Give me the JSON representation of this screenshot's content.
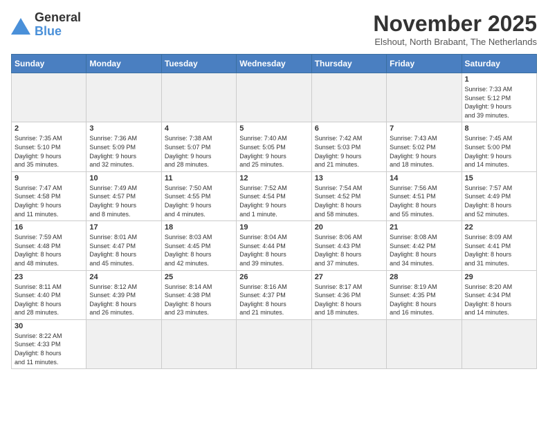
{
  "header": {
    "logo_line1": "General",
    "logo_line2": "Blue",
    "month_title": "November 2025",
    "location": "Elshout, North Brabant, The Netherlands"
  },
  "weekdays": [
    "Sunday",
    "Monday",
    "Tuesday",
    "Wednesday",
    "Thursday",
    "Friday",
    "Saturday"
  ],
  "weeks": [
    [
      {
        "day": "",
        "info": "",
        "empty": true
      },
      {
        "day": "",
        "info": "",
        "empty": true
      },
      {
        "day": "",
        "info": "",
        "empty": true
      },
      {
        "day": "",
        "info": "",
        "empty": true
      },
      {
        "day": "",
        "info": "",
        "empty": true
      },
      {
        "day": "",
        "info": "",
        "empty": true
      },
      {
        "day": "1",
        "info": "Sunrise: 7:33 AM\nSunset: 5:12 PM\nDaylight: 9 hours\nand 39 minutes."
      }
    ],
    [
      {
        "day": "2",
        "info": "Sunrise: 7:35 AM\nSunset: 5:10 PM\nDaylight: 9 hours\nand 35 minutes."
      },
      {
        "day": "3",
        "info": "Sunrise: 7:36 AM\nSunset: 5:09 PM\nDaylight: 9 hours\nand 32 minutes."
      },
      {
        "day": "4",
        "info": "Sunrise: 7:38 AM\nSunset: 5:07 PM\nDaylight: 9 hours\nand 28 minutes."
      },
      {
        "day": "5",
        "info": "Sunrise: 7:40 AM\nSunset: 5:05 PM\nDaylight: 9 hours\nand 25 minutes."
      },
      {
        "day": "6",
        "info": "Sunrise: 7:42 AM\nSunset: 5:03 PM\nDaylight: 9 hours\nand 21 minutes."
      },
      {
        "day": "7",
        "info": "Sunrise: 7:43 AM\nSunset: 5:02 PM\nDaylight: 9 hours\nand 18 minutes."
      },
      {
        "day": "8",
        "info": "Sunrise: 7:45 AM\nSunset: 5:00 PM\nDaylight: 9 hours\nand 14 minutes."
      }
    ],
    [
      {
        "day": "9",
        "info": "Sunrise: 7:47 AM\nSunset: 4:58 PM\nDaylight: 9 hours\nand 11 minutes."
      },
      {
        "day": "10",
        "info": "Sunrise: 7:49 AM\nSunset: 4:57 PM\nDaylight: 9 hours\nand 8 minutes."
      },
      {
        "day": "11",
        "info": "Sunrise: 7:50 AM\nSunset: 4:55 PM\nDaylight: 9 hours\nand 4 minutes."
      },
      {
        "day": "12",
        "info": "Sunrise: 7:52 AM\nSunset: 4:54 PM\nDaylight: 9 hours\nand 1 minute."
      },
      {
        "day": "13",
        "info": "Sunrise: 7:54 AM\nSunset: 4:52 PM\nDaylight: 8 hours\nand 58 minutes."
      },
      {
        "day": "14",
        "info": "Sunrise: 7:56 AM\nSunset: 4:51 PM\nDaylight: 8 hours\nand 55 minutes."
      },
      {
        "day": "15",
        "info": "Sunrise: 7:57 AM\nSunset: 4:49 PM\nDaylight: 8 hours\nand 52 minutes."
      }
    ],
    [
      {
        "day": "16",
        "info": "Sunrise: 7:59 AM\nSunset: 4:48 PM\nDaylight: 8 hours\nand 48 minutes."
      },
      {
        "day": "17",
        "info": "Sunrise: 8:01 AM\nSunset: 4:47 PM\nDaylight: 8 hours\nand 45 minutes."
      },
      {
        "day": "18",
        "info": "Sunrise: 8:03 AM\nSunset: 4:45 PM\nDaylight: 8 hours\nand 42 minutes."
      },
      {
        "day": "19",
        "info": "Sunrise: 8:04 AM\nSunset: 4:44 PM\nDaylight: 8 hours\nand 39 minutes."
      },
      {
        "day": "20",
        "info": "Sunrise: 8:06 AM\nSunset: 4:43 PM\nDaylight: 8 hours\nand 37 minutes."
      },
      {
        "day": "21",
        "info": "Sunrise: 8:08 AM\nSunset: 4:42 PM\nDaylight: 8 hours\nand 34 minutes."
      },
      {
        "day": "22",
        "info": "Sunrise: 8:09 AM\nSunset: 4:41 PM\nDaylight: 8 hours\nand 31 minutes."
      }
    ],
    [
      {
        "day": "23",
        "info": "Sunrise: 8:11 AM\nSunset: 4:40 PM\nDaylight: 8 hours\nand 28 minutes."
      },
      {
        "day": "24",
        "info": "Sunrise: 8:12 AM\nSunset: 4:39 PM\nDaylight: 8 hours\nand 26 minutes."
      },
      {
        "day": "25",
        "info": "Sunrise: 8:14 AM\nSunset: 4:38 PM\nDaylight: 8 hours\nand 23 minutes."
      },
      {
        "day": "26",
        "info": "Sunrise: 8:16 AM\nSunset: 4:37 PM\nDaylight: 8 hours\nand 21 minutes."
      },
      {
        "day": "27",
        "info": "Sunrise: 8:17 AM\nSunset: 4:36 PM\nDaylight: 8 hours\nand 18 minutes."
      },
      {
        "day": "28",
        "info": "Sunrise: 8:19 AM\nSunset: 4:35 PM\nDaylight: 8 hours\nand 16 minutes."
      },
      {
        "day": "29",
        "info": "Sunrise: 8:20 AM\nSunset: 4:34 PM\nDaylight: 8 hours\nand 14 minutes."
      }
    ],
    [
      {
        "day": "30",
        "info": "Sunrise: 8:22 AM\nSunset: 4:33 PM\nDaylight: 8 hours\nand 11 minutes."
      },
      {
        "day": "",
        "info": "",
        "empty": true
      },
      {
        "day": "",
        "info": "",
        "empty": true
      },
      {
        "day": "",
        "info": "",
        "empty": true
      },
      {
        "day": "",
        "info": "",
        "empty": true
      },
      {
        "day": "",
        "info": "",
        "empty": true
      },
      {
        "day": "",
        "info": "",
        "empty": true
      }
    ]
  ]
}
